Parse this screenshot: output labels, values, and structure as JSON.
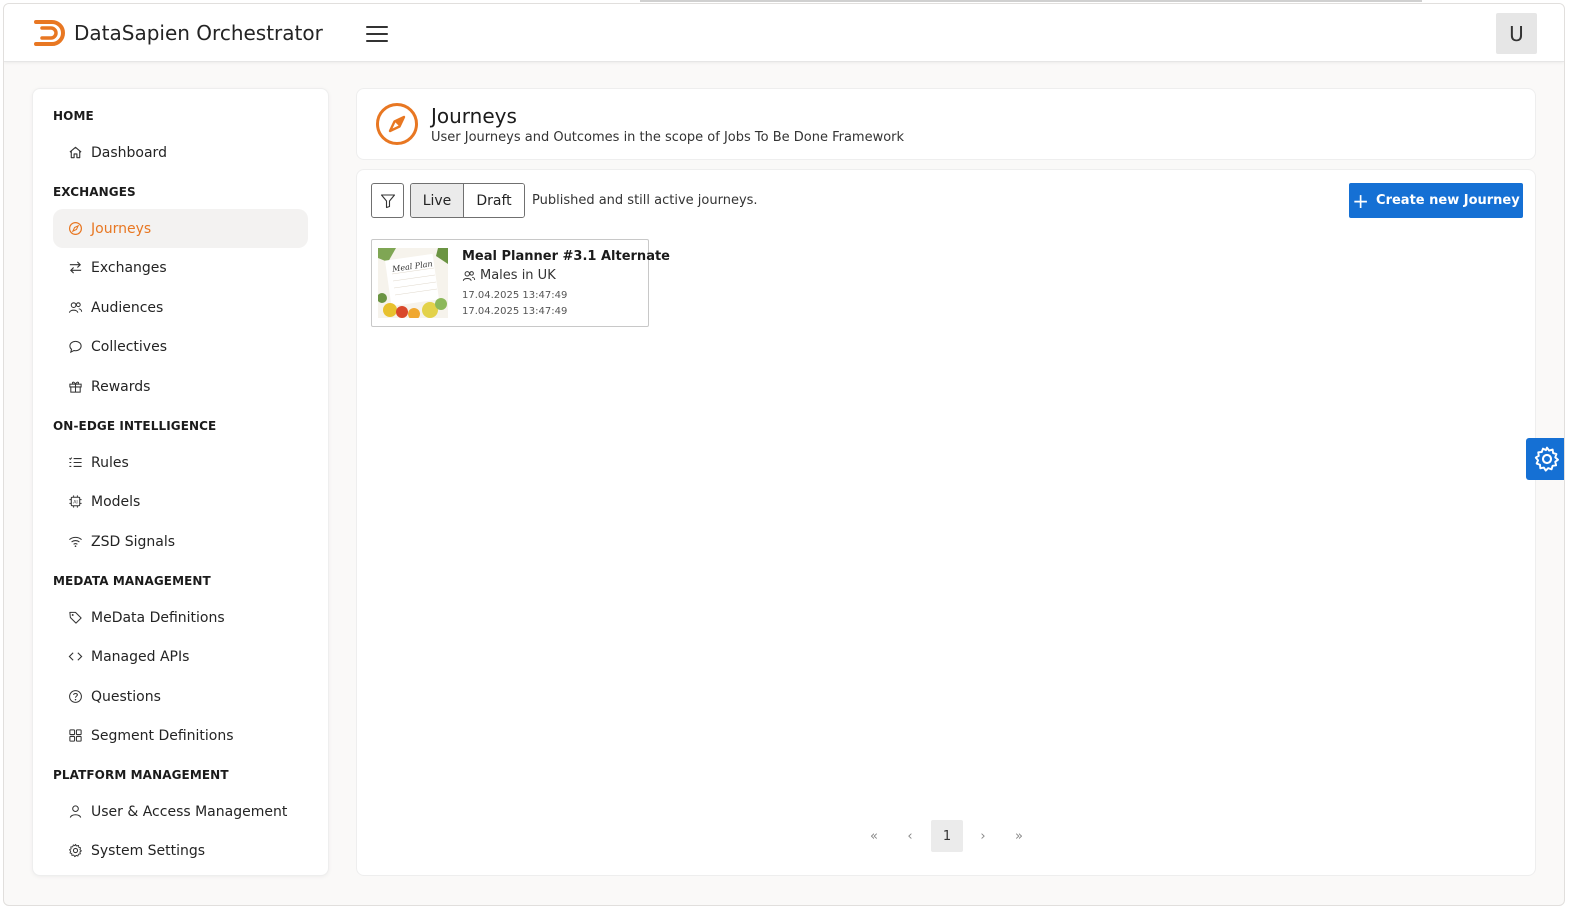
{
  "app": {
    "title": "DataSapien Orchestrator",
    "user_initial": "U"
  },
  "sidebar": {
    "sections": [
      {
        "title": "HOME",
        "items": [
          {
            "label": "Dashboard",
            "icon": "home-icon"
          }
        ]
      },
      {
        "title": "EXCHANGES",
        "items": [
          {
            "label": "Journeys",
            "icon": "compass-icon",
            "active": true
          },
          {
            "label": "Exchanges",
            "icon": "arrows-swap-icon"
          },
          {
            "label": "Audiences",
            "icon": "people-icon"
          },
          {
            "label": "Collectives",
            "icon": "chat-icon"
          },
          {
            "label": "Rewards",
            "icon": "gift-icon"
          }
        ]
      },
      {
        "title": "ON-EDGE INTELLIGENCE",
        "items": [
          {
            "label": "Rules",
            "icon": "list-check-icon"
          },
          {
            "label": "Models",
            "icon": "ai-chip-icon"
          },
          {
            "label": "ZSD Signals",
            "icon": "wifi-icon"
          }
        ]
      },
      {
        "title": "MEDATA MANAGEMENT",
        "items": [
          {
            "label": "MeData Definitions",
            "icon": "tag-icon"
          },
          {
            "label": "Managed APIs",
            "icon": "code-icon"
          },
          {
            "label": "Questions",
            "icon": "question-icon"
          },
          {
            "label": "Segment Definitions",
            "icon": "grid-icon"
          }
        ]
      },
      {
        "title": "PLATFORM MANAGEMENT",
        "items": [
          {
            "label": "User & Access Management",
            "icon": "person-icon"
          },
          {
            "label": "System Settings",
            "icon": "gear-icon"
          }
        ]
      }
    ]
  },
  "header": {
    "title": "Journeys",
    "subtitle": "User Journeys and Outcomes in the scope of Jobs To Be Done Framework"
  },
  "toolbar": {
    "live_label": "Live",
    "draft_label": "Draft",
    "description": "Published and still active journeys.",
    "create_label": "Create new Journey"
  },
  "journeys": [
    {
      "title": "Meal Planner #3.1 Alternate",
      "audience": "Males in UK",
      "created": "17.04.2025 13:47:49",
      "updated": "17.04.2025 13:47:49",
      "thumb_text": "Meal Plan"
    }
  ],
  "pagination": {
    "first": "«",
    "prev": "‹",
    "current": "1",
    "next": "›",
    "last": "»"
  },
  "colors": {
    "accent": "#e87722",
    "primary": "#1570d4"
  }
}
